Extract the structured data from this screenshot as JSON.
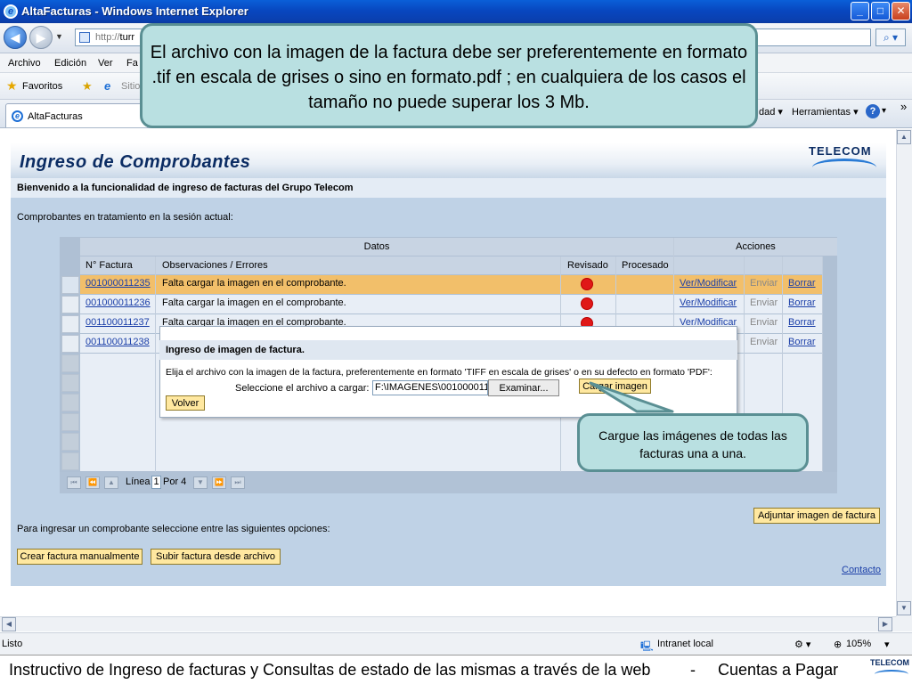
{
  "browser": {
    "title": "AltaFacturas - Windows Internet Explorer",
    "url_prefix": "http://",
    "url_visible": "turr",
    "menu": [
      "Archivo",
      "Edición",
      "Ver",
      "Fa"
    ],
    "favorites_label": "Favoritos",
    "favorites_site": "Sitio",
    "tab_label": "AltaFacturas",
    "tools_seguridad": "dad ▾",
    "tools_herramientas": "Herramientas ▾",
    "help": "?",
    "more": "»",
    "status_text": "Listo",
    "zone": "Intranet local",
    "zoom": "105%"
  },
  "page": {
    "title": "Ingreso de Comprobantes",
    "logo": "TELECOM",
    "welcome": "Bienvenido a la funcionalidad de ingreso de facturas del Grupo Telecom",
    "session_label": "Comprobantes en tratamiento en la sesión actual:",
    "table": {
      "group_datos": "Datos",
      "group_acciones": "Acciones",
      "col_factura": "N° Factura",
      "col_obs": "Observaciones / Errores",
      "col_revisado": "Revisado",
      "col_procesado": "Procesado",
      "rows": [
        {
          "factura": "001000011235",
          "obs": "Falta cargar la imagen en el comprobante.",
          "ver": "Ver/Modificar",
          "enviar": "Enviar",
          "borrar": "Borrar"
        },
        {
          "factura": "001000011236",
          "obs": "Falta cargar la imagen en el comprobante.",
          "ver": "Ver/Modificar",
          "enviar": "Enviar",
          "borrar": "Borrar"
        },
        {
          "factura": "001100011237",
          "obs": "Falta cargar la imagen en el comprobante.",
          "ver": "Ver/Modificar",
          "enviar": "Enviar",
          "borrar": "Borrar"
        },
        {
          "factura": "001100011238",
          "obs": "",
          "ver": "",
          "enviar": "Enviar",
          "borrar": "Borrar"
        }
      ],
      "pager_label": "Línea",
      "pager_value": "1",
      "pager_of": "Por 4"
    },
    "modal": {
      "title": "Ingreso de imagen de factura.",
      "instruction": "Elija el archivo con la imagen de la factura, preferentemente en formato 'TIFF en escala de grises' o en su defecto en formato 'PDF':",
      "select_label": "Seleccione el archivo a cargar:",
      "file_value": "F:\\IMAGENES\\0010000112",
      "browse": "Examinar...",
      "upload": "Cargar imagen",
      "back": "Volver"
    },
    "attach_button": "Adjuntar imagen de factura",
    "options_label": "Para ingresar un comprobante seleccione entre las siguientes opciones:",
    "create_manual": "Crear factura manualmente",
    "upload_file": "Subir factura desde archivo",
    "contact": "Contacto"
  },
  "callouts": {
    "top": "El archivo con la imagen de la factura debe ser preferentemente en formato .tif en escala de grises o sino en formato.pdf ; en cualquiera de los casos el tamaño no puede superar los 3 Mb.",
    "bottom": "Cargue las imágenes de todas las facturas una a una."
  },
  "footer": {
    "text": "Instructivo de Ingreso de facturas y Consultas de estado de las mismas a través de la web",
    "separator": "-",
    "section": "Cuentas a Pagar",
    "logo": "TELECOM"
  },
  "colors": {
    "highlight_row": "#f2bf6a",
    "status_red": "#e01818",
    "callout_fill": "#b9e0e1"
  }
}
